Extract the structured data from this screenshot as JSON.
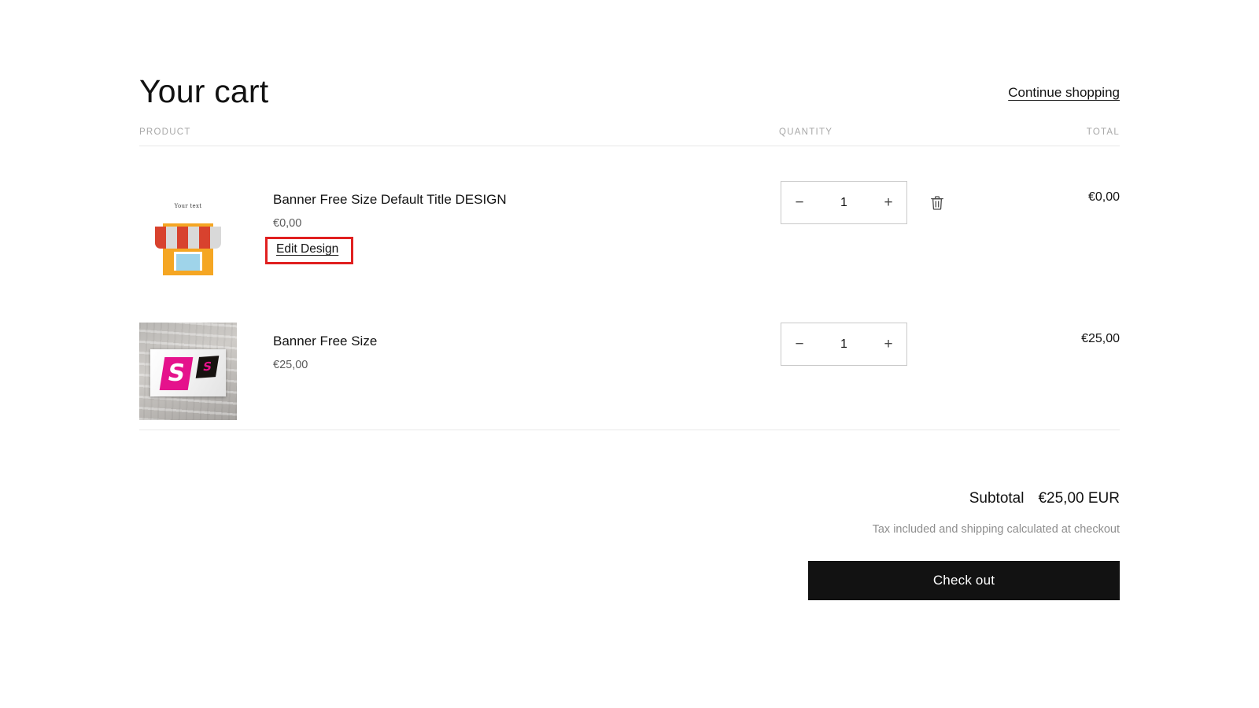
{
  "header": {
    "title": "Your cart",
    "continue_shopping": "Continue shopping"
  },
  "table": {
    "columns": {
      "product": "PRODUCT",
      "quantity": "QUANTITY",
      "total": "TOTAL"
    }
  },
  "items": [
    {
      "title": "Banner Free Size Default Title DESIGN",
      "price": "€0,00",
      "edit_link": "Edit Design",
      "quantity": "1",
      "decrease_label": "−",
      "increase_label": "+",
      "line_total": "€0,00",
      "thumb_placeholder_text": "Your text",
      "flag_letter": "",
      "has_remove": true
    },
    {
      "title": "Banner Free Size",
      "price": "€25,00",
      "edit_link": "",
      "quantity": "1",
      "decrease_label": "−",
      "increase_label": "+",
      "line_total": "€25,00",
      "thumb_placeholder_text": "",
      "flag_letter": "S",
      "has_remove": false
    }
  ],
  "summary": {
    "subtotal_label": "Subtotal",
    "subtotal_value": "€25,00 EUR",
    "tax_note": "Tax included and shipping calculated at checkout",
    "checkout_label": "Check out"
  },
  "colors": {
    "accent_annotation": "#e02020",
    "button_background": "#121212",
    "text_primary": "#121212",
    "text_muted": "#8e8e8e",
    "rule": "#e8e8e8"
  }
}
